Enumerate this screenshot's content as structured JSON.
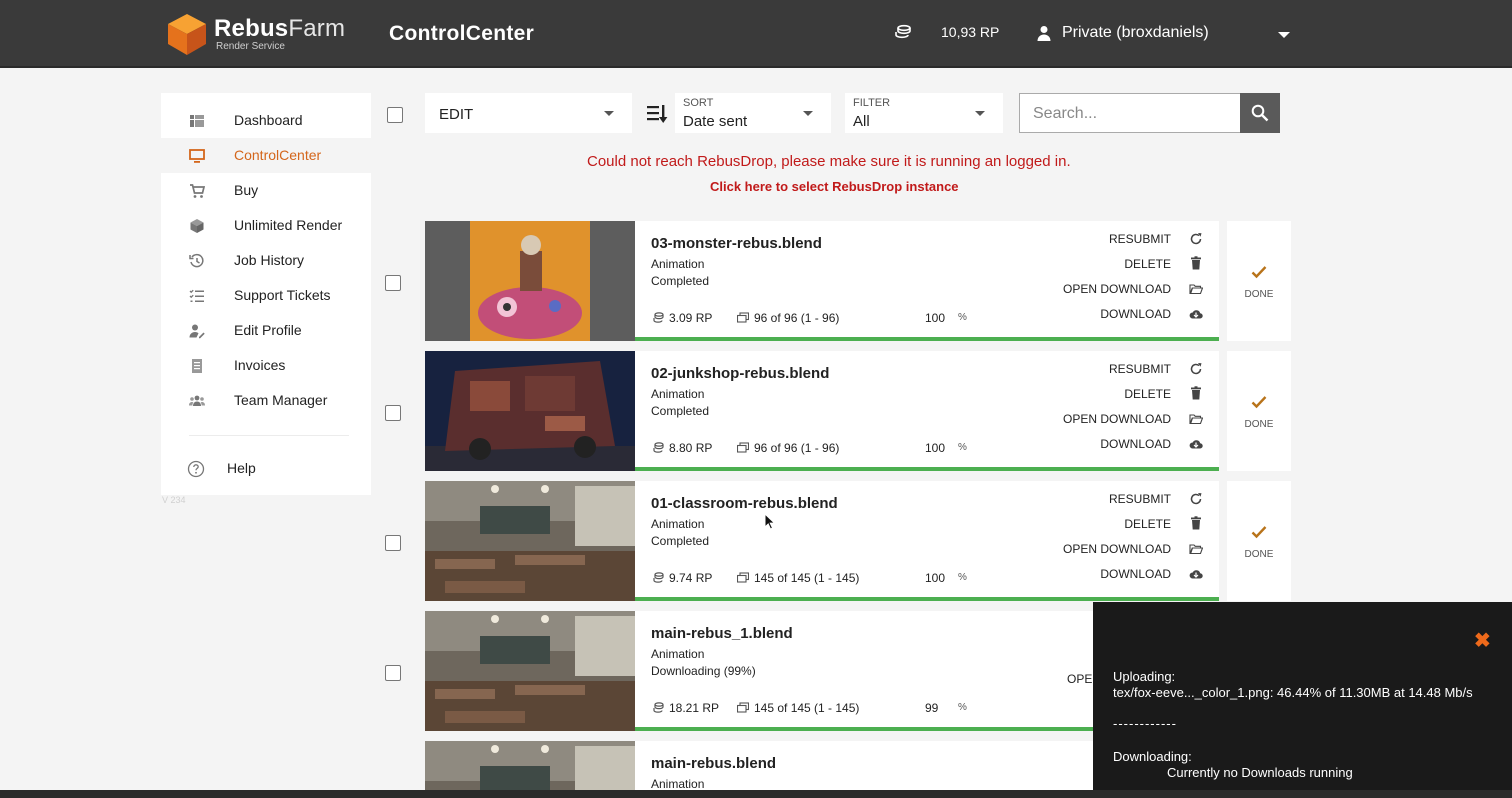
{
  "header": {
    "brand_main": "Rebus",
    "brand_light": "Farm",
    "brand_sub": "Render Service",
    "app_title": "ControlCenter",
    "credits": "10,93 RP",
    "account": "Private (broxdaniels)"
  },
  "sidebar": {
    "items": [
      {
        "label": "Dashboard",
        "icon": "dashboard-icon"
      },
      {
        "label": "ControlCenter",
        "icon": "monitor-icon"
      },
      {
        "label": "Buy",
        "icon": "cart-icon"
      },
      {
        "label": "Unlimited Render",
        "icon": "box-icon"
      },
      {
        "label": "Job History",
        "icon": "history-icon"
      },
      {
        "label": "Support Tickets",
        "icon": "checklist-icon"
      },
      {
        "label": "Edit Profile",
        "icon": "user-edit-icon"
      },
      {
        "label": "Invoices",
        "icon": "invoice-icon"
      },
      {
        "label": "Team Manager",
        "icon": "team-icon"
      }
    ],
    "help": "Help",
    "version": "V 234"
  },
  "toolbar": {
    "edit": "EDIT",
    "sort_caption": "SORT",
    "sort_value": "Date sent",
    "filter_caption": "FILTER",
    "filter_value": "All",
    "search_placeholder": "Search..."
  },
  "errors": {
    "message": "Could not reach RebusDrop, please make sure it is running an logged in.",
    "link": "Click here to select RebusDrop instance"
  },
  "actions": {
    "resubmit": "RESUBMIT",
    "delete": "DELETE",
    "open_download": "OPEN DOWNLOAD",
    "download": "DOWNLOAD",
    "done": "DONE"
  },
  "jobs": [
    {
      "name": "03-monster-rebus.blend",
      "type": "Animation",
      "status": "Completed",
      "cost": "3.09 RP",
      "frames": "96 of 96 (1 - 96)",
      "percent": "100",
      "progress": 1.0
    },
    {
      "name": "02-junkshop-rebus.blend",
      "type": "Animation",
      "status": "Completed",
      "cost": "8.80 RP",
      "frames": "96 of 96 (1 - 96)",
      "percent": "100",
      "progress": 1.0
    },
    {
      "name": "01-classroom-rebus.blend",
      "type": "Animation",
      "status": "Completed",
      "cost": "9.74 RP",
      "frames": "145 of 145 (1 - 145)",
      "percent": "100",
      "progress": 1.0
    },
    {
      "name": "main-rebus_1.blend",
      "type": "Animation",
      "status": "Downloading (99%)",
      "cost": "18.21 RP",
      "frames": "145 of 145 (1 - 145)",
      "percent": "99",
      "progress": 0.99,
      "partial_action": "OPE"
    },
    {
      "name": "main-rebus.blend",
      "type": "Animation"
    }
  ],
  "toast": {
    "uploading_label": "Uploading:",
    "uploading_detail": "tex/fox-eeve..._color_1.png:  46.44% of 11.30MB at 14.48 Mb/s",
    "separator": "------------",
    "downloading_label": "Downloading:",
    "downloading_detail": "Currently no Downloads running"
  },
  "colors": {
    "accent": "#d4661b",
    "error": "#c11a1a",
    "progress": "#4caf50",
    "topbar": "#3a3a3a",
    "toast_close": "#ee6a1b"
  }
}
